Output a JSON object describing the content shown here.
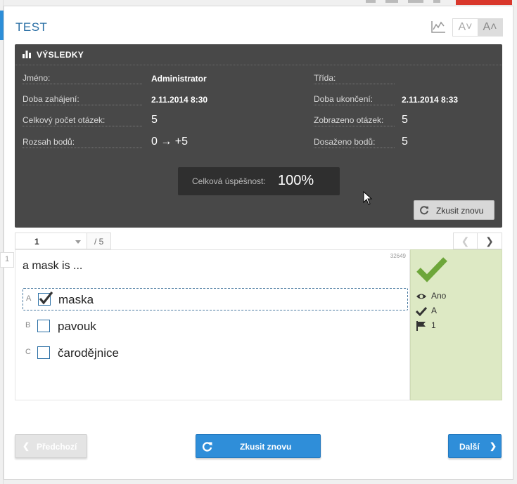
{
  "colors": {
    "accent": "#2f8ed9",
    "results_bg": "#484848",
    "correct_bg": "#dde9c4",
    "correct_icon": "#6da63a"
  },
  "page": {
    "title": "TEST"
  },
  "toolbar": {
    "chart_icon": "chart-line-icon",
    "font_smaller": "A˅",
    "font_larger": "A˄"
  },
  "results": {
    "title": "VÝSLEDKY",
    "name_label": "Jméno:",
    "name_value": "Administrator",
    "class_label": "Třída:",
    "class_value": "",
    "start_label": "Doba zahájení:",
    "start_value": "2.11.2014 8:30",
    "end_label": "Doba ukončení:",
    "end_value": "2.11.2014 8:33",
    "total_q_label": "Celkový počet otázek:",
    "total_q_value": "5",
    "shown_q_label": "Zobrazeno otázek:",
    "shown_q_value": "5",
    "range_label": "Rozsah bodů:",
    "range_value": "0 → +5",
    "scored_label": "Dosaženo bodů:",
    "scored_value": "5",
    "success_label": "Celková úspěšnost:",
    "success_value": "100%",
    "retry_label": "Zkusit znovu"
  },
  "pager": {
    "current": "1",
    "total": "/ 5",
    "side_number": "1"
  },
  "question": {
    "id": "32649",
    "text": "a mask is ...",
    "options": [
      {
        "letter": "A",
        "text": "maska",
        "checked": true
      },
      {
        "letter": "B",
        "text": "pavouk",
        "checked": false
      },
      {
        "letter": "C",
        "text": "čarodějnice",
        "checked": false
      }
    ]
  },
  "evaluation": {
    "answered": "Ano",
    "correct_answer": "A",
    "points": "1"
  },
  "footer": {
    "prev_label": "Předchozí",
    "retry_label": "Zkusit znovu",
    "next_label": "Další"
  }
}
